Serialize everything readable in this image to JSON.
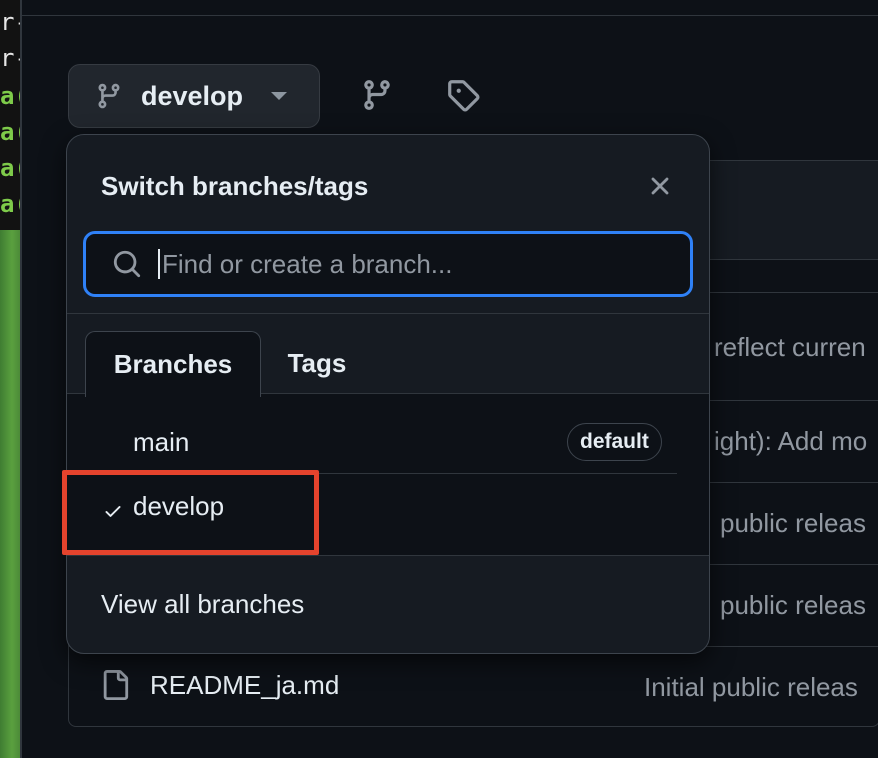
{
  "terminal": {
    "lines": [
      {
        "text": "r-",
        "style": "w"
      },
      {
        "text": "r-",
        "style": "w"
      },
      {
        "text": "a(",
        "style": "g"
      },
      {
        "text": "a(",
        "style": "g"
      },
      {
        "text": "a(",
        "style": "g"
      },
      {
        "text": "a(",
        "style": "g"
      }
    ]
  },
  "toolbar": {
    "branch_label": "develop",
    "branch_icon": "git-branch-icon",
    "branches_icon": "git-branch-icon",
    "tags_icon": "tag-icon"
  },
  "dropdown": {
    "title": "Switch branches/tags",
    "search_placeholder": "Find or create a branch...",
    "tabs": [
      {
        "label": "Branches",
        "active": true
      },
      {
        "label": "Tags",
        "active": false
      }
    ],
    "branches": [
      {
        "name": "main",
        "badge": "default",
        "selected": false
      },
      {
        "name": "develop",
        "badge": "",
        "selected": true
      }
    ],
    "view_all": "View all branches"
  },
  "background": {
    "commit_fragments": [
      "reflect curren",
      "ight): Add mo",
      "public releas",
      "public releas",
      "Initial public releas"
    ],
    "file_name": "README_ja.md"
  },
  "colors": {
    "accent": "#2f81f7",
    "highlight": "#e4432d",
    "background": "#0d1117",
    "panel": "#161b22"
  }
}
